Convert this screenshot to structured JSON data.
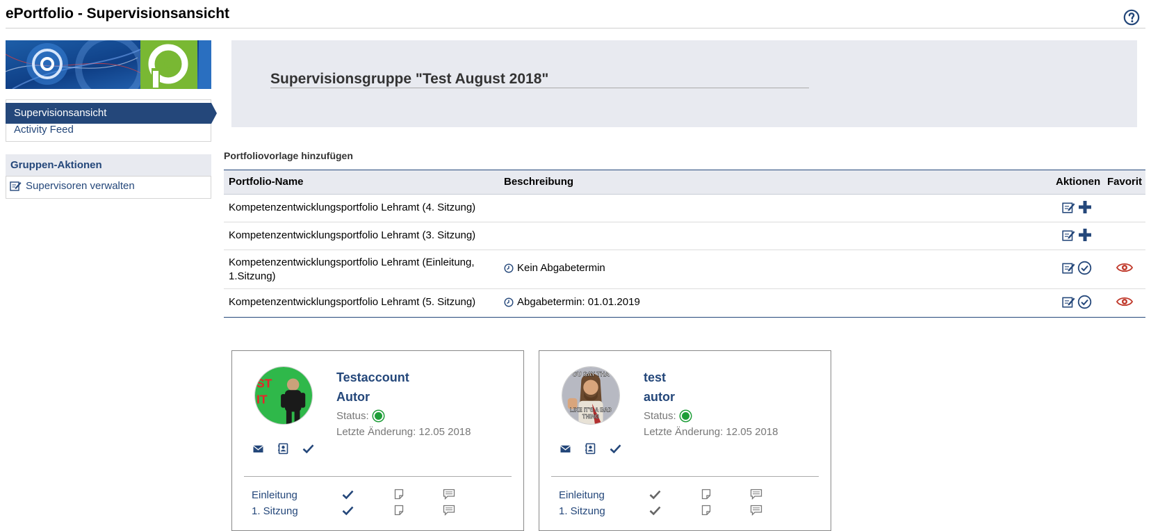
{
  "header": {
    "title": "ePortfolio - Supervisionsansicht"
  },
  "sidebar": {
    "nav": [
      {
        "label": "Supervisionsansicht",
        "active": true
      },
      {
        "label": "Activity Feed",
        "active": false
      }
    ],
    "group": {
      "title": "Gruppen-Aktionen",
      "actions": [
        {
          "label": "Supervisoren verwalten",
          "icon": "edit-icon"
        }
      ]
    }
  },
  "main": {
    "group_title": "Supervisionsgruppe \"Test August 2018\"",
    "add_template_label": "Portfoliovorlage hinzufügen",
    "table": {
      "columns": [
        "Portfolio-Name",
        "Beschreibung",
        "Aktionen",
        "Favorit"
      ],
      "rows": [
        {
          "name_line1": "Kompetenzentwicklungsportfolio Lehramt (4. Sitzung)",
          "name_line2": "",
          "description": "",
          "action": "add",
          "favorite": false
        },
        {
          "name_line1": "Kompetenzentwicklungsportfolio Lehramt (3. Sitzung)",
          "name_line2": "",
          "description": "",
          "action": "add",
          "favorite": false
        },
        {
          "name_line1": "Kompetenzentwicklungsportfolio Lehramt (Einleitung,",
          "name_line2": "1.Sitzung)",
          "description": "Kein Abgabetermin",
          "action": "check",
          "favorite": true
        },
        {
          "name_line1": "Kompetenzentwicklungsportfolio Lehramt (5. Sitzung)",
          "name_line2": "",
          "description": "Abgabetermin: 01.01.2019",
          "action": "check",
          "favorite": true
        }
      ]
    },
    "cards": [
      {
        "name": "Testaccount",
        "role": "Autor",
        "status_label": "Status:",
        "status_color": "#1e9e38",
        "last_change": "Letzte Änderung: 12.05 2018",
        "avatar_lettering": "ST IT",
        "sessions": [
          "Einleitung",
          "1. Sitzung"
        ],
        "sessions_completed": [
          true,
          true
        ]
      },
      {
        "name": "test",
        "role": "autor",
        "status_label": "Status:",
        "status_color": "#1e9e38",
        "last_change": "Letzte Änderung: 12.05 2018",
        "avatar_lettering": "OU SAY THA LIKE IT'S A BAD THING",
        "sessions": [
          "Einleitung",
          "1. Sitzung"
        ],
        "sessions_completed": [
          false,
          false
        ]
      }
    ]
  },
  "colors": {
    "brand": "#24477a",
    "panel": "#e8eaf0",
    "favorite": "#c0392b",
    "status_ok": "#1e9e38"
  }
}
